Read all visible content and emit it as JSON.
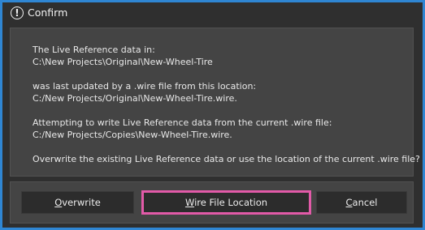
{
  "window": {
    "title": "Confirm",
    "icon": "exclamation-circle-icon",
    "icon_glyph": "!"
  },
  "message": {
    "line1": "The Live Reference data in:",
    "line2": "C:\\New Projects\\Original\\New-Wheel-Tire",
    "line3": "was last updated by a .wire file from this location:",
    "line4": "C:/New Projects/Original\\New-Wheel-Tire.wire.",
    "line5": "Attempting to write Live Reference data from the current .wire file:",
    "line6": "C:/New Projects/Copies\\New-Wheel-Tire.wire.",
    "line7": "Overwrite the existing Live Reference data or use the location of the current .wire file?"
  },
  "buttons": {
    "overwrite": {
      "mnemonic": "O",
      "rest": "verwrite"
    },
    "wire_location": {
      "mnemonic": "W",
      "rest": "ire File Location"
    },
    "cancel": {
      "mnemonic": "C",
      "rest": "ancel"
    }
  },
  "colors": {
    "window_border": "#2f86d3",
    "highlight_border": "#e25aa8",
    "background": "#2f2f2f",
    "panel": "#444444"
  }
}
